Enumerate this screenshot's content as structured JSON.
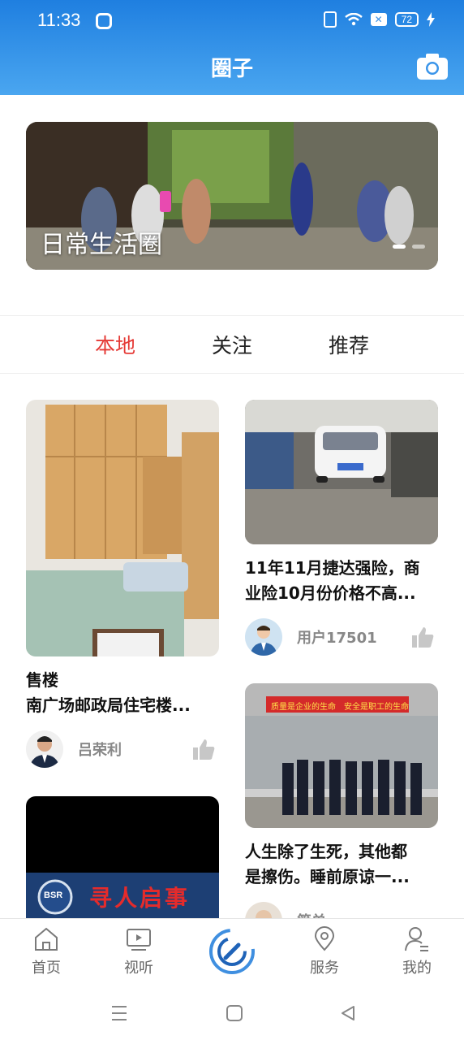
{
  "status_bar": {
    "time": "11:33",
    "battery": "72"
  },
  "header": {
    "title": "圈子"
  },
  "banner": {
    "caption": "日常生活圈"
  },
  "tabs": [
    {
      "label": "本地",
      "active": true
    },
    {
      "label": "关注",
      "active": false
    },
    {
      "label": "推荐",
      "active": false
    }
  ],
  "feed": {
    "left": [
      {
        "title_line1": "售楼",
        "title_line2": "南广场邮政局住宅楼...",
        "author": "吕荣利"
      },
      {
        "image_text": "寻人启事",
        "logo_text": "BSR"
      }
    ],
    "right": [
      {
        "title_line1": "11年11月捷达强险，商",
        "title_line2": "业险10月份价格不高...",
        "author": "用户17501"
      },
      {
        "banner_text": "质量是企业的生命　安全是职工的生命",
        "title_line1": "人生除了生死，其他都",
        "title_line2": "是擦伤。睡前原谅一...",
        "author": "简单"
      }
    ]
  },
  "bottom_nav": [
    {
      "label": "首页",
      "icon": "home-icon"
    },
    {
      "label": "视听",
      "icon": "tv-icon"
    },
    {
      "label": "",
      "icon": "circle-center-icon"
    },
    {
      "label": "服务",
      "icon": "location-icon"
    },
    {
      "label": "我的",
      "icon": "profile-icon"
    }
  ],
  "colors": {
    "header_top": "#1f7fe0",
    "header_bottom": "#4aa6f0",
    "active_tab": "#e53935"
  }
}
